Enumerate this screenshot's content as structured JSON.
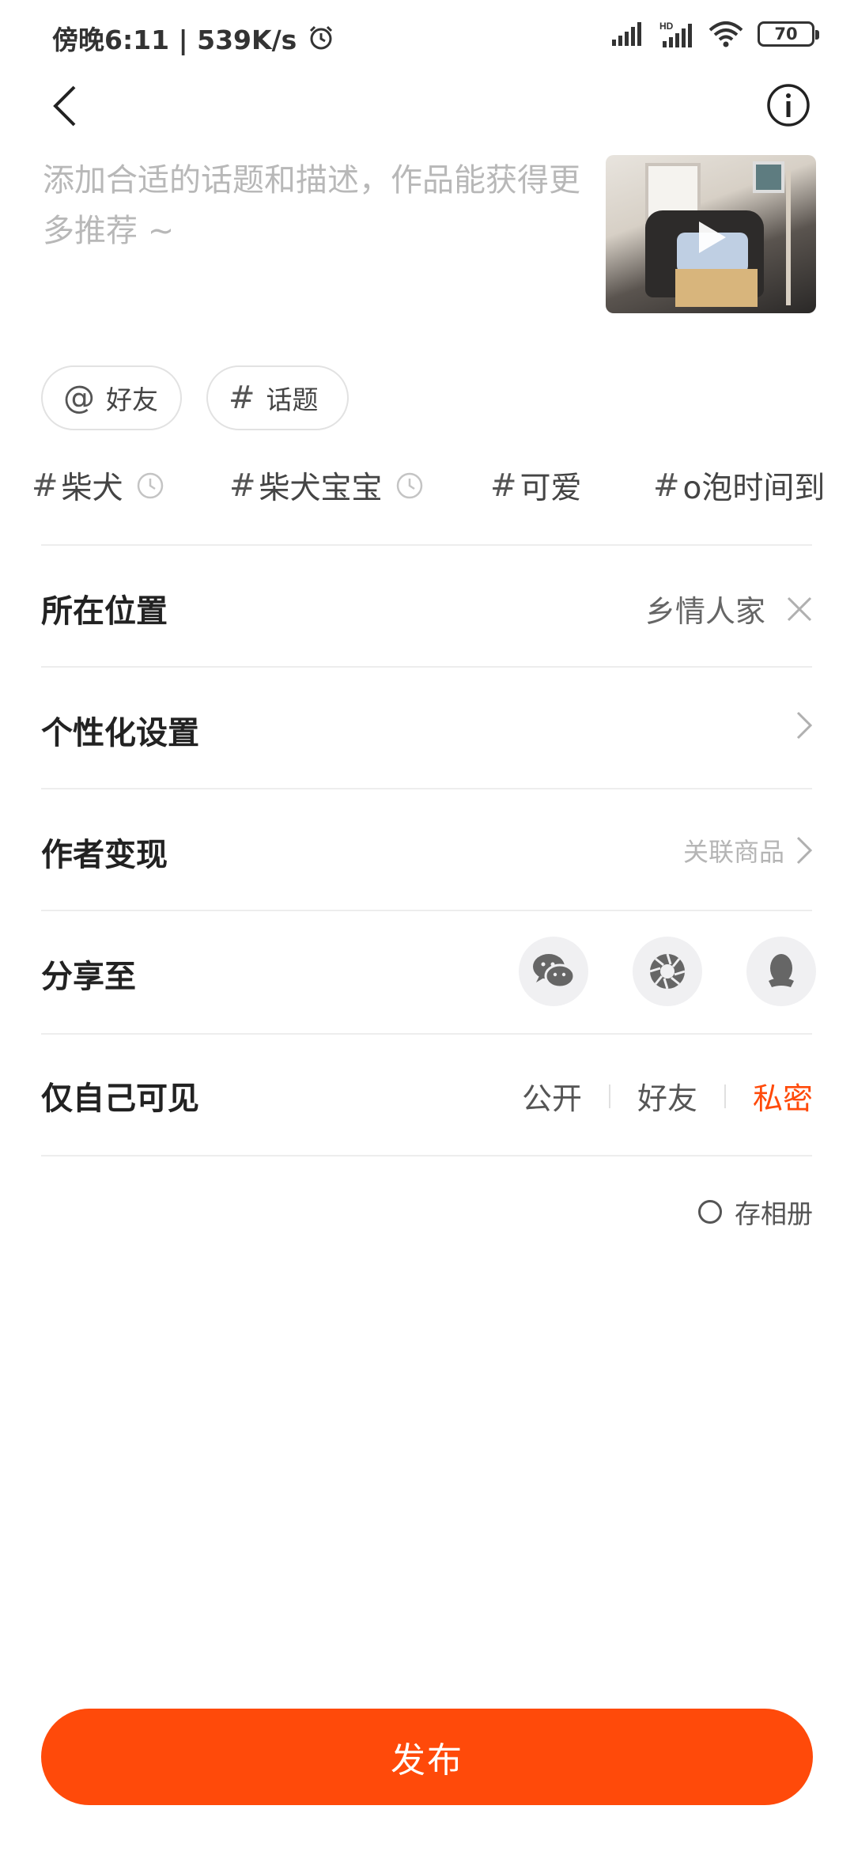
{
  "status_bar": {
    "time_speed": "傍晚6:11 | 539K/s",
    "network_hd": "HD",
    "battery": "70"
  },
  "header": {
    "back_icon": "chevron-left-icon",
    "info_icon": "info-circle-icon"
  },
  "post": {
    "description_placeholder": "添加合适的话题和描述，作品能获得更多推荐 ~"
  },
  "chips": {
    "mention": {
      "symbol": "@",
      "label": "好友"
    },
    "topic": {
      "symbol": "#",
      "label": "话题"
    }
  },
  "topic_suggestions": [
    {
      "hash": "#",
      "label": "柴犬"
    },
    {
      "hash": "#",
      "label": "柴犬宝宝"
    },
    {
      "hash": "#",
      "label": "可爱"
    },
    {
      "hash": "#",
      "label": "o泡时间到"
    }
  ],
  "rows": {
    "location": {
      "label": "所在位置",
      "value": "乡情人家"
    },
    "personalize": {
      "label": "个性化设置"
    },
    "monetize": {
      "label": "作者变现",
      "link": "关联商品"
    },
    "share": {
      "label": "分享至",
      "targets": [
        "wechat-icon",
        "moments-icon",
        "qq-icon"
      ]
    },
    "visibility": {
      "label": "仅自己可见",
      "options": [
        "公开",
        "好友",
        "私密"
      ],
      "selected": "私密",
      "accent": "#ff4a0a"
    }
  },
  "save_album": {
    "label": "存相册"
  },
  "publish": {
    "label": "发布",
    "color": "#ff4a0a"
  }
}
